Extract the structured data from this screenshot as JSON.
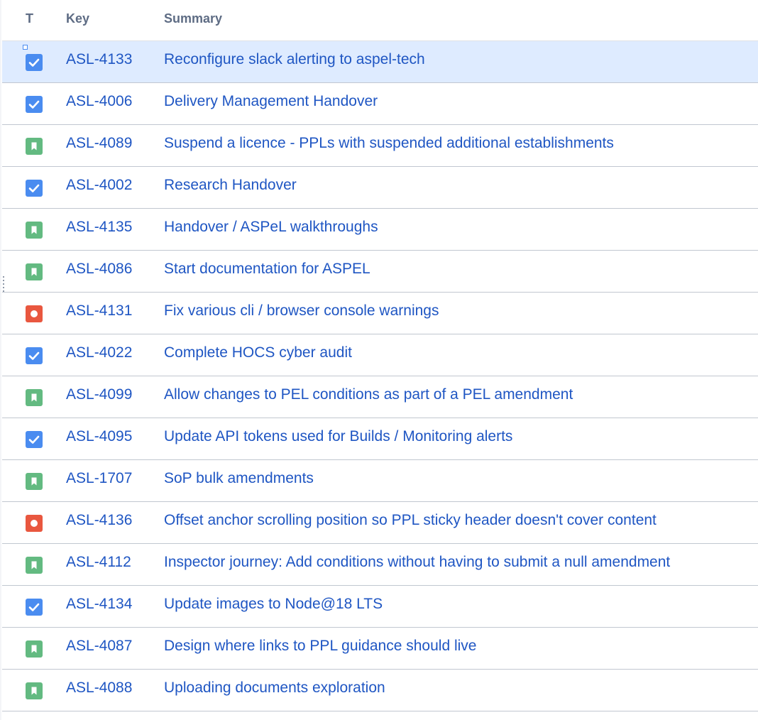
{
  "columns": {
    "type": "T",
    "key": "Key",
    "summary": "Summary"
  },
  "rows": [
    {
      "type": "task",
      "key": "ASL-4133",
      "summary": "Reconfigure slack alerting to aspel-tech",
      "selected": true
    },
    {
      "type": "task",
      "key": "ASL-4006",
      "summary": "Delivery Management Handover"
    },
    {
      "type": "story",
      "key": "ASL-4089",
      "summary": "Suspend a licence - PPLs with suspended additional establishments"
    },
    {
      "type": "task",
      "key": "ASL-4002",
      "summary": "Research Handover"
    },
    {
      "type": "story",
      "key": "ASL-4135",
      "summary": "Handover / ASPeL walkthroughs"
    },
    {
      "type": "story",
      "key": "ASL-4086",
      "summary": "Start documentation for ASPEL"
    },
    {
      "type": "bug",
      "key": "ASL-4131",
      "summary": "Fix various cli / browser console warnings"
    },
    {
      "type": "task",
      "key": "ASL-4022",
      "summary": "Complete HOCS cyber audit"
    },
    {
      "type": "story",
      "key": "ASL-4099",
      "summary": "Allow changes to PEL conditions as part of a PEL amendment"
    },
    {
      "type": "task",
      "key": "ASL-4095",
      "summary": "Update API tokens used for Builds / Monitoring alerts"
    },
    {
      "type": "story",
      "key": "ASL-1707",
      "summary": "SoP bulk amendments"
    },
    {
      "type": "bug",
      "key": "ASL-4136",
      "summary": "Offset anchor scrolling position so PPL sticky header doesn't cover content"
    },
    {
      "type": "story",
      "key": "ASL-4112",
      "summary": "Inspector journey: Add conditions without having to submit a null amendment"
    },
    {
      "type": "task",
      "key": "ASL-4134",
      "summary": "Update images to Node@18 LTS"
    },
    {
      "type": "story",
      "key": "ASL-4087",
      "summary": "Design where links to PPL guidance should live"
    },
    {
      "type": "story",
      "key": "ASL-4088",
      "summary": "Uploading documents exploration"
    }
  ],
  "icons": {
    "task": {
      "name": "task-icon",
      "color": "#4a8cf0"
    },
    "story": {
      "name": "story-icon",
      "color": "#63ba81"
    },
    "bug": {
      "name": "bug-icon",
      "color": "#e9573f"
    }
  },
  "colors": {
    "link": "#1f56c3",
    "header_text": "#5e6c84",
    "selected_row": "#deebff",
    "row_border": "#c1c7d0"
  }
}
